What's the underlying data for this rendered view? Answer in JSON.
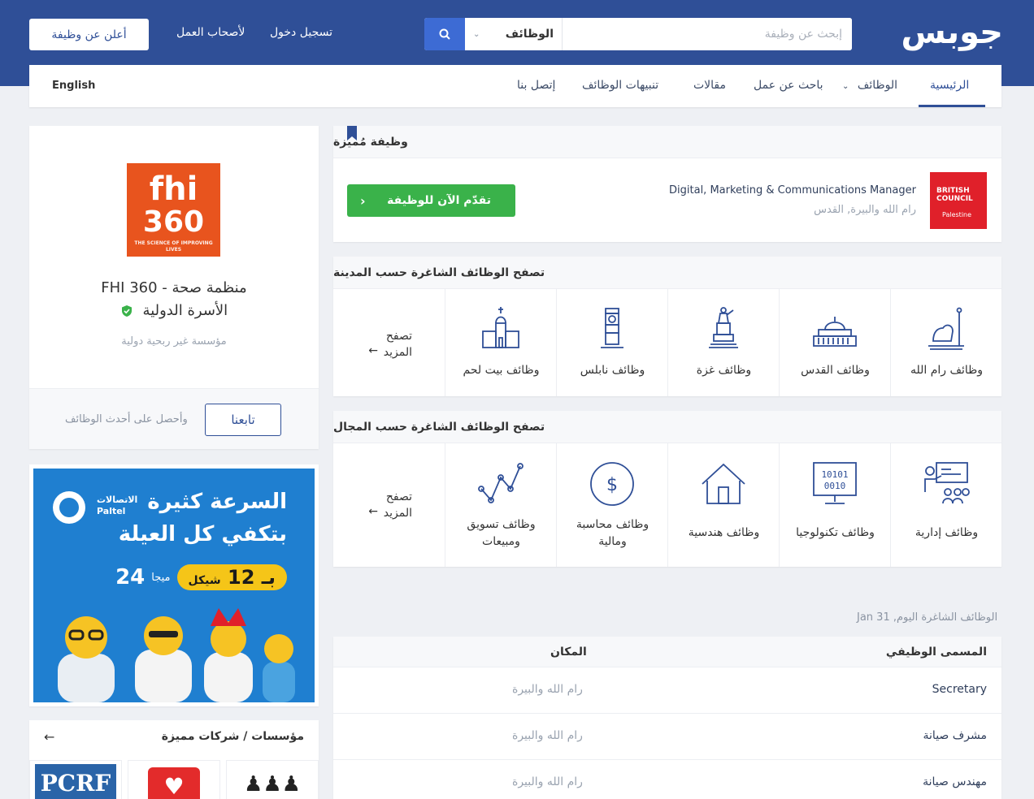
{
  "header": {
    "logo_text": "جوبس",
    "search": {
      "placeholder": "إبحث عن وظيفة",
      "category_value": "الوظائف"
    },
    "links": {
      "login": "تسجيل دخول",
      "employers": "لأصحاب العمل",
      "post_job": "أعلن عن وظيفة"
    }
  },
  "nav": {
    "items": [
      {
        "label": "الرئيسية",
        "active": true
      },
      {
        "label": "الوظائف"
      },
      {
        "label": "باحث عن عمل"
      },
      {
        "label": "مقالات"
      },
      {
        "label": "تنبيهات الوظائف"
      },
      {
        "label": "إتصل بنا"
      }
    ],
    "language": "English"
  },
  "company": {
    "logo_text": {
      "line1": "fhi",
      "line2": "360",
      "tagline": "THE SCIENCE OF IMPROVING LIVES"
    },
    "name_line1": "منظمة صحة - FHI 360",
    "name_line2": "الأسرة الدولية",
    "type": "مؤسسة غير ربحية دولية",
    "follow_label": "تابعنا",
    "follow_note": "وأحصل على أحدث الوظائف"
  },
  "ad": {
    "line1": "السرعة كثيرة",
    "line2": "بتكفي كل العيلة",
    "brand_ar": "الاتصالات",
    "brand_en": "Paltel",
    "speed_value": "24",
    "speed_unit": "ميجا",
    "price_prefix": "بـ",
    "price_value": "12",
    "price_unit": "شيكل"
  },
  "featured_companies": {
    "title": "مؤسسات / شركات مميزة",
    "logos": {
      "pcrf": "PCRF"
    }
  },
  "featured_job": {
    "section_title": "وظيفة مُميزة",
    "company_logo": {
      "line1": "BRITISH",
      "line2": "COUNCIL",
      "country": "Palestine"
    },
    "title": "Digital, Marketing & Communications Manager",
    "location": "رام الله والبيرة, القدس",
    "apply_label": "تقدّم الآن للوظيفة"
  },
  "browse_cities": {
    "title": "تصفح الوظائف الشاغرة حسب المدينة",
    "tiles": [
      {
        "label": "وظائف رام الله",
        "icon": "lion-statue-icon"
      },
      {
        "label": "وظائف القدس",
        "icon": "dome-of-rock-icon"
      },
      {
        "label": "وظائف غزة",
        "icon": "soldier-monument-icon"
      },
      {
        "label": "وظائف نابلس",
        "icon": "clock-tower-icon"
      },
      {
        "label": "وظائف بيت لحم",
        "icon": "church-icon"
      }
    ],
    "more": {
      "line1": "تصفح",
      "line2": "المزيد"
    }
  },
  "browse_fields": {
    "title": "تصفح الوظائف الشاغرة حسب المجال",
    "tiles": [
      {
        "label": "وظائف إدارية",
        "icon": "management-icon"
      },
      {
        "label": "وظائف تكنولوجيا",
        "icon": "computer-icon"
      },
      {
        "label": "وظائف هندسية",
        "icon": "house-icon"
      },
      {
        "label_line1": "وظائف محاسبة",
        "label_line2": "ومالية",
        "icon": "dollar-icon"
      },
      {
        "label_line1": "وظائف تسويق",
        "label_line2": "ومبيعات",
        "icon": "line-chart-icon"
      }
    ],
    "more": {
      "line1": "تصفح",
      "line2": "المزيد"
    }
  },
  "todays_jobs": {
    "label": "الوظائف الشاغرة اليوم, Jan 31",
    "columns": {
      "title": "المسمى الوظيفي",
      "location": "المكان"
    },
    "rows": [
      {
        "title": "Secretary",
        "location": "رام الله والبيرة"
      },
      {
        "title": "مشرف صيانة",
        "location": "رام الله والبيرة"
      },
      {
        "title": "مهندس صيانة",
        "location": "رام الله والبيرة"
      }
    ]
  },
  "colors": {
    "brand": "#2f4f97",
    "accent_blue": "#3d6bd4",
    "apply_green": "#3ab24a",
    "fhi_orange": "#e8541e",
    "british_council_red": "#e0202a"
  }
}
